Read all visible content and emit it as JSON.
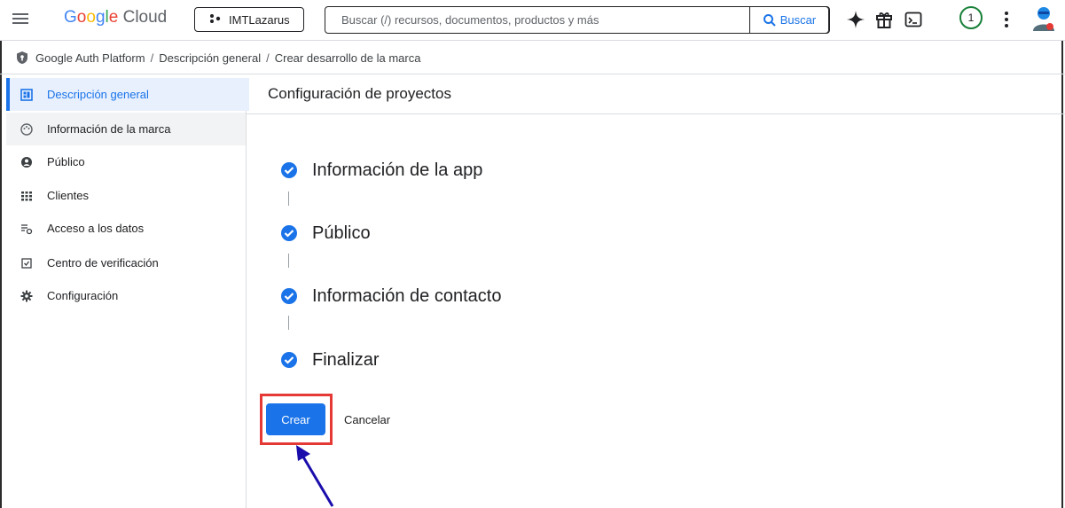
{
  "colors": {
    "accent": "#1a73e8",
    "highlight_box": "#e53935",
    "arrow": "#1a0dab",
    "check": "#1a73e8"
  },
  "topbar": {
    "logo_parts": [
      "G",
      "o",
      "o",
      "g",
      "l",
      "e"
    ],
    "logo_cloud": "Cloud",
    "project_name": "IMTLazarus",
    "search_placeholder": "Buscar (/) recursos, documentos, productos y más",
    "search_button": "Buscar",
    "notification_count": "1",
    "icons": [
      "menu-icon",
      "project-icon",
      "search-icon",
      "gemini-sparkle-icon",
      "gift-icon",
      "cloud-shell-icon",
      "more-vert-icon",
      "avatar"
    ]
  },
  "breadcrumb": {
    "items": [
      "Google Auth Platform",
      "Descripción general",
      "Crear desarrollo de la marca"
    ],
    "separator": "/"
  },
  "sidebar": {
    "items": [
      {
        "label": "Descripción general",
        "icon": "dashboard-icon",
        "active": true
      },
      {
        "label": "Información de la marca",
        "icon": "palette-icon"
      },
      {
        "label": "Público",
        "icon": "account-circle-icon"
      },
      {
        "label": "Clientes",
        "icon": "grid-icon"
      },
      {
        "label": "Acceso a los datos",
        "icon": "data-access-icon"
      },
      {
        "label": "Centro de verificación",
        "icon": "verification-icon"
      },
      {
        "label": "Configuración",
        "icon": "settings-icon"
      }
    ]
  },
  "main": {
    "title": "Configuración de proyectos",
    "steps": [
      {
        "label": "Información de la app",
        "status": "complete"
      },
      {
        "label": "Público",
        "status": "complete"
      },
      {
        "label": "Información de contacto",
        "status": "complete"
      },
      {
        "label": "Finalizar",
        "status": "complete"
      }
    ],
    "create_button": "Crear",
    "cancel_button": "Cancelar"
  }
}
